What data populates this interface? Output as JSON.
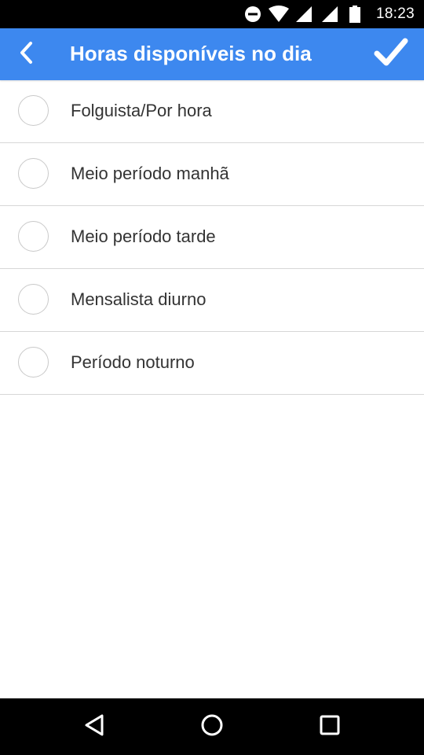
{
  "status_bar": {
    "time": "18:23",
    "icons": [
      "do-not-disturb-icon",
      "wifi-icon",
      "signal-icon",
      "signal-icon",
      "battery-icon"
    ]
  },
  "app_bar": {
    "title": "Horas disponíveis no dia",
    "back_icon": "chevron-left-icon",
    "confirm_icon": "check-icon",
    "color": "#3d88ef"
  },
  "options": [
    {
      "label": "Folguista/Por hora",
      "selected": false
    },
    {
      "label": "Meio período manhã",
      "selected": false
    },
    {
      "label": "Meio período tarde",
      "selected": false
    },
    {
      "label": "Mensalista diurno",
      "selected": false
    },
    {
      "label": "Período noturno",
      "selected": false
    }
  ],
  "nav_bar": {
    "icons": [
      "back-triangle-icon",
      "home-circle-icon",
      "recents-square-icon"
    ]
  }
}
